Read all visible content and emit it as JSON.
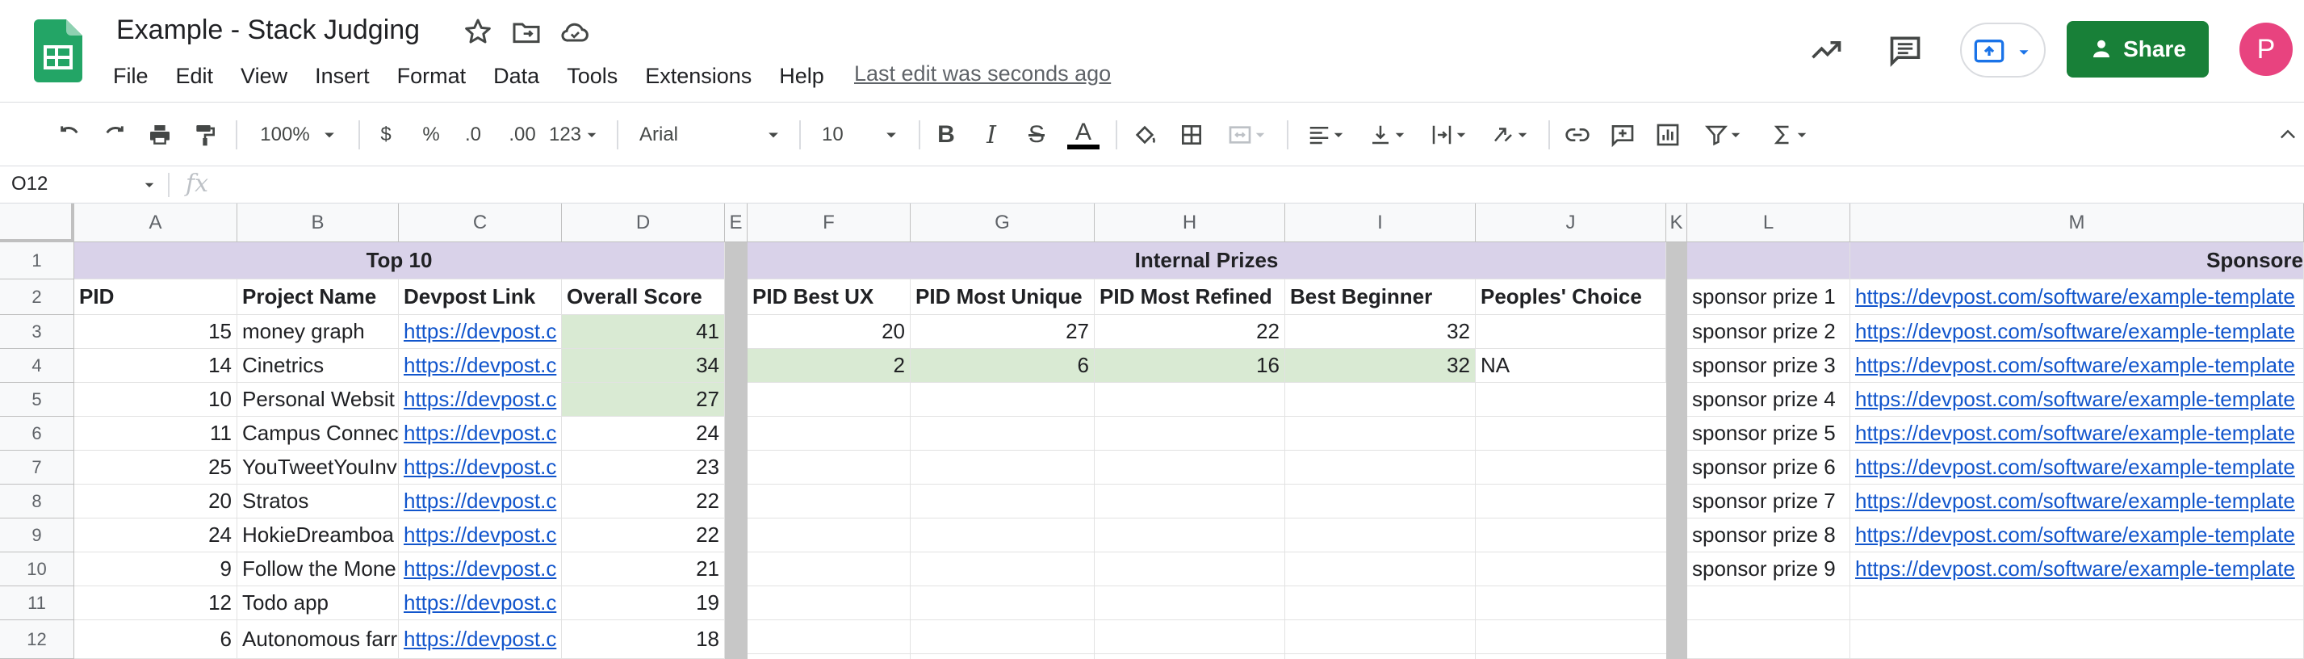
{
  "header": {
    "title": "Example - Stack Judging",
    "menu": [
      "File",
      "Edit",
      "View",
      "Insert",
      "Format",
      "Data",
      "Tools",
      "Extensions",
      "Help"
    ],
    "last_edit": "Last edit was seconds ago",
    "share_label": "Share",
    "avatar_letter": "P",
    "share_color": "#188038",
    "avatar_color": "#e8437f"
  },
  "toolbar": {
    "zoom": "100%",
    "currency": "$",
    "percent": "%",
    "dec_decrease": ".0",
    "dec_increase": ".00",
    "more_formats": "123",
    "font": "Arial",
    "font_size": "10",
    "bold": "B",
    "italic": "I",
    "strike": "S",
    "text_color": "A"
  },
  "formula_bar": {
    "cell_ref": "O12",
    "fx": "fx",
    "value": ""
  },
  "grid": {
    "columns": [
      "A",
      "B",
      "C",
      "D",
      "E",
      "F",
      "G",
      "H",
      "I",
      "J",
      "K",
      "L",
      "M"
    ],
    "rows": [
      "1",
      "2",
      "3",
      "4",
      "5",
      "6",
      "7",
      "8",
      "9",
      "10",
      "11",
      "12"
    ],
    "top10": {
      "title": "Top 10",
      "headers": [
        "PID",
        "Project Name",
        "Devpost Link",
        "Overall Score"
      ],
      "rows": [
        {
          "pid": "15",
          "name": "money graph",
          "link": "https://devpost.c",
          "score": "41"
        },
        {
          "pid": "14",
          "name": "Cinetrics",
          "link": "https://devpost.c",
          "score": "34"
        },
        {
          "pid": "10",
          "name": "Personal Websit",
          "link": "https://devpost.c",
          "score": "27"
        },
        {
          "pid": "11",
          "name": "Campus Connec",
          "link": "https://devpost.c",
          "score": "24"
        },
        {
          "pid": "25",
          "name": "YouTweetYouInv",
          "link": "https://devpost.c",
          "score": "23"
        },
        {
          "pid": "20",
          "name": "Stratos",
          "link": "https://devpost.c",
          "score": "22"
        },
        {
          "pid": "24",
          "name": "HokieDreamboa",
          "link": "https://devpost.c",
          "score": "22"
        },
        {
          "pid": "9",
          "name": "Follow the Mone",
          "link": "https://devpost.c",
          "score": "21"
        },
        {
          "pid": "12",
          "name": "Todo app",
          "link": "https://devpost.c",
          "score": "19"
        },
        {
          "pid": "6",
          "name": "Autonomous farr",
          "link": "https://devpost.c",
          "score": "18"
        }
      ]
    },
    "internal": {
      "title": "Internal Prizes",
      "headers": [
        "PID Best UX",
        "PID Most Unique",
        "PID Most Refined",
        "Best Beginner",
        "Peoples' Choice"
      ],
      "row3": [
        "20",
        "27",
        "22",
        "32",
        ""
      ],
      "row4": [
        "2",
        "6",
        "16",
        "32",
        "NA"
      ]
    },
    "sponsor": {
      "title": "Sponsore",
      "rows": [
        {
          "name": "sponsor prize 1",
          "link": "https://devpost.com/software/example-template"
        },
        {
          "name": "sponsor prize 2",
          "link": "https://devpost.com/software/example-template"
        },
        {
          "name": "sponsor prize 3",
          "link": "https://devpost.com/software/example-template"
        },
        {
          "name": "sponsor prize 4",
          "link": "https://devpost.com/software/example-template"
        },
        {
          "name": "sponsor prize 5",
          "link": "https://devpost.com/software/example-template"
        },
        {
          "name": "sponsor prize 6",
          "link": "https://devpost.com/software/example-template"
        },
        {
          "name": "sponsor prize 7",
          "link": "https://devpost.com/software/example-template"
        },
        {
          "name": "sponsor prize 8",
          "link": "https://devpost.com/software/example-template"
        },
        {
          "name": "sponsor prize 9",
          "link": "https://devpost.com/software/example-template"
        }
      ]
    },
    "colors": {
      "band": "#d9d2e9",
      "highlight": "#d9ead3",
      "link": "#1155cc"
    }
  }
}
